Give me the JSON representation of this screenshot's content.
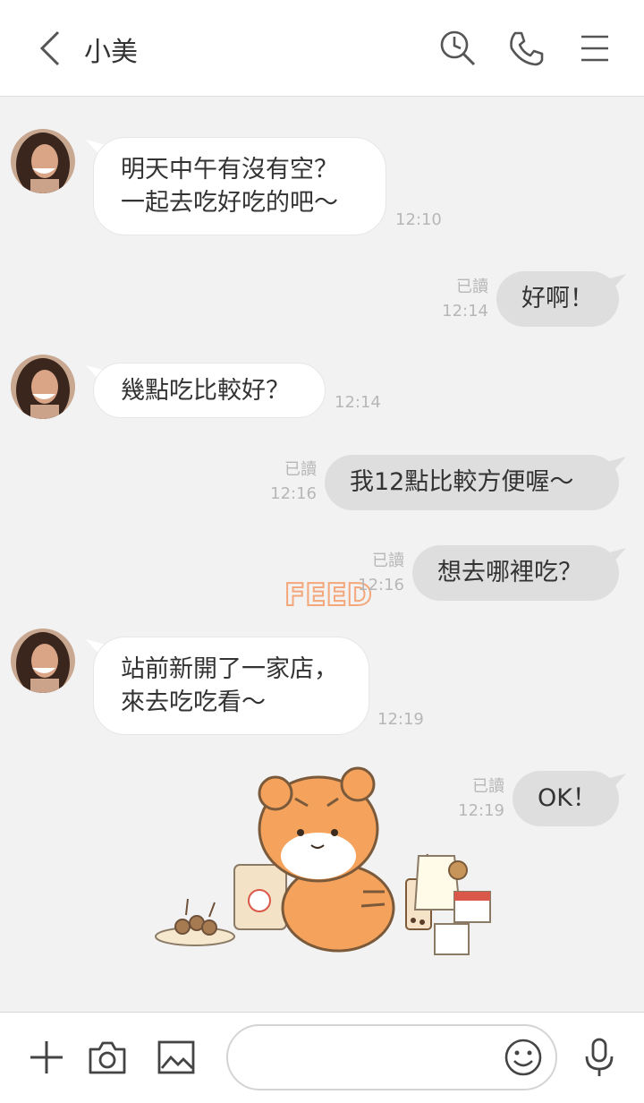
{
  "header": {
    "title": "小美",
    "icons": [
      "back-icon",
      "search-history-icon",
      "phone-icon",
      "menu-icon"
    ]
  },
  "messages": [
    {
      "side": "in",
      "lines": [
        "明天中午有沒有空？",
        "一起去吃好吃的吧～"
      ],
      "time": "12:10"
    },
    {
      "side": "out",
      "text": "好啊！",
      "read": "已讀",
      "time": "12:14"
    },
    {
      "side": "in",
      "text": "幾點吃比較好？",
      "time": "12:14"
    },
    {
      "side": "out",
      "text": "我12點比較方便喔～",
      "read": "已讀",
      "time": "12:16"
    },
    {
      "side": "out",
      "text": "想去哪裡吃？",
      "read": "已讀",
      "time": "12:16"
    },
    {
      "side": "in",
      "lines": [
        "站前新開了一家店，",
        "來去吃吃看～"
      ],
      "time": "12:19"
    },
    {
      "side": "out",
      "text": "OK！",
      "read": "已讀",
      "time": "12:19"
    }
  ],
  "background_text": "FEED ME",
  "footer": {
    "icons": [
      "plus-icon",
      "camera-icon",
      "image-icon",
      "emoji-icon",
      "microphone-icon"
    ],
    "input_value": ""
  },
  "colors": {
    "chat_bg": "#f2f2f2",
    "bubble_in": "#ffffff",
    "bubble_out": "#dedede",
    "meta_text": "#b7b7b7",
    "sticker_orange": "#f5a35c"
  }
}
